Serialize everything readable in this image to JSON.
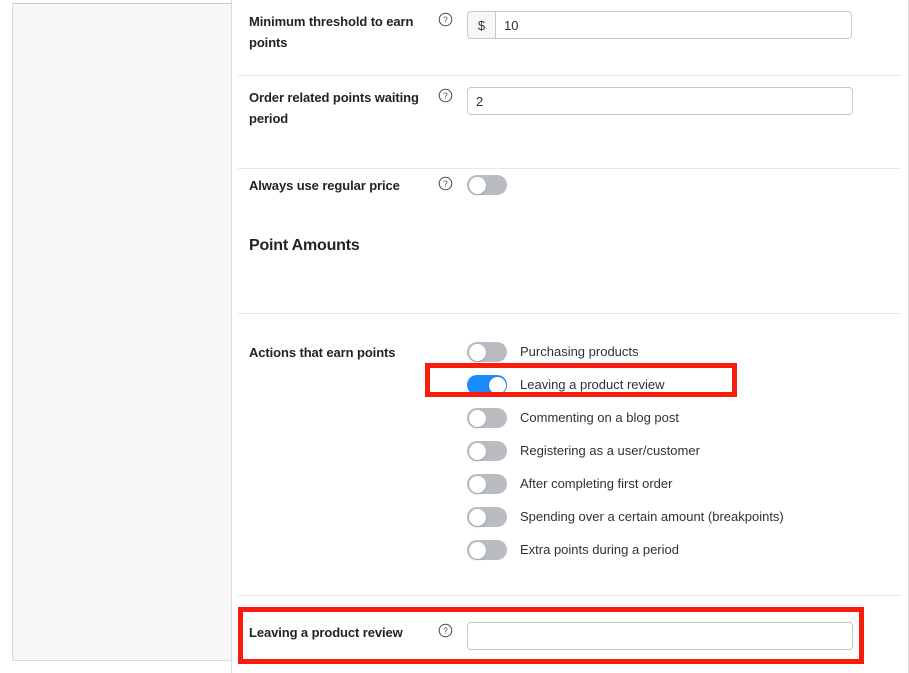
{
  "colors": {
    "accent_on": "#1a8cff",
    "toggle_off": "#b9bcc0",
    "highlight": "#f91c0d",
    "panel_bg": "#f7f7f7",
    "text": "#2c3338",
    "border": "#c9c9c9"
  },
  "settings": {
    "rows": [
      {
        "label": "Minimum threshold to earn points",
        "help_icon": "help-circle-icon",
        "prefix": "$",
        "value": "10",
        "placeholder": ""
      },
      {
        "label": "Order related points waiting period",
        "help_icon": "help-circle-icon",
        "value": "2",
        "placeholder": ""
      },
      {
        "label": "Always use regular price",
        "help_icon": "help-circle-icon",
        "toggle": false
      }
    ],
    "section_heading": "Point Amounts",
    "actions": {
      "label": "Actions that earn points",
      "items": [
        {
          "label": "Purchasing products",
          "on": false
        },
        {
          "label": "Leaving a product review",
          "on": true
        },
        {
          "label": "Commenting on a blog post",
          "on": false
        },
        {
          "label": "Registering as a user/customer",
          "on": false
        },
        {
          "label": "After completing first order",
          "on": false
        },
        {
          "label": "Spending over a certain amount (breakpoints)",
          "on": false
        },
        {
          "label": "Extra points during a period",
          "on": false
        }
      ]
    },
    "point_amount_row": {
      "label": "Leaving a product review",
      "help_icon": "help-circle-icon",
      "value": "",
      "placeholder": ""
    }
  }
}
